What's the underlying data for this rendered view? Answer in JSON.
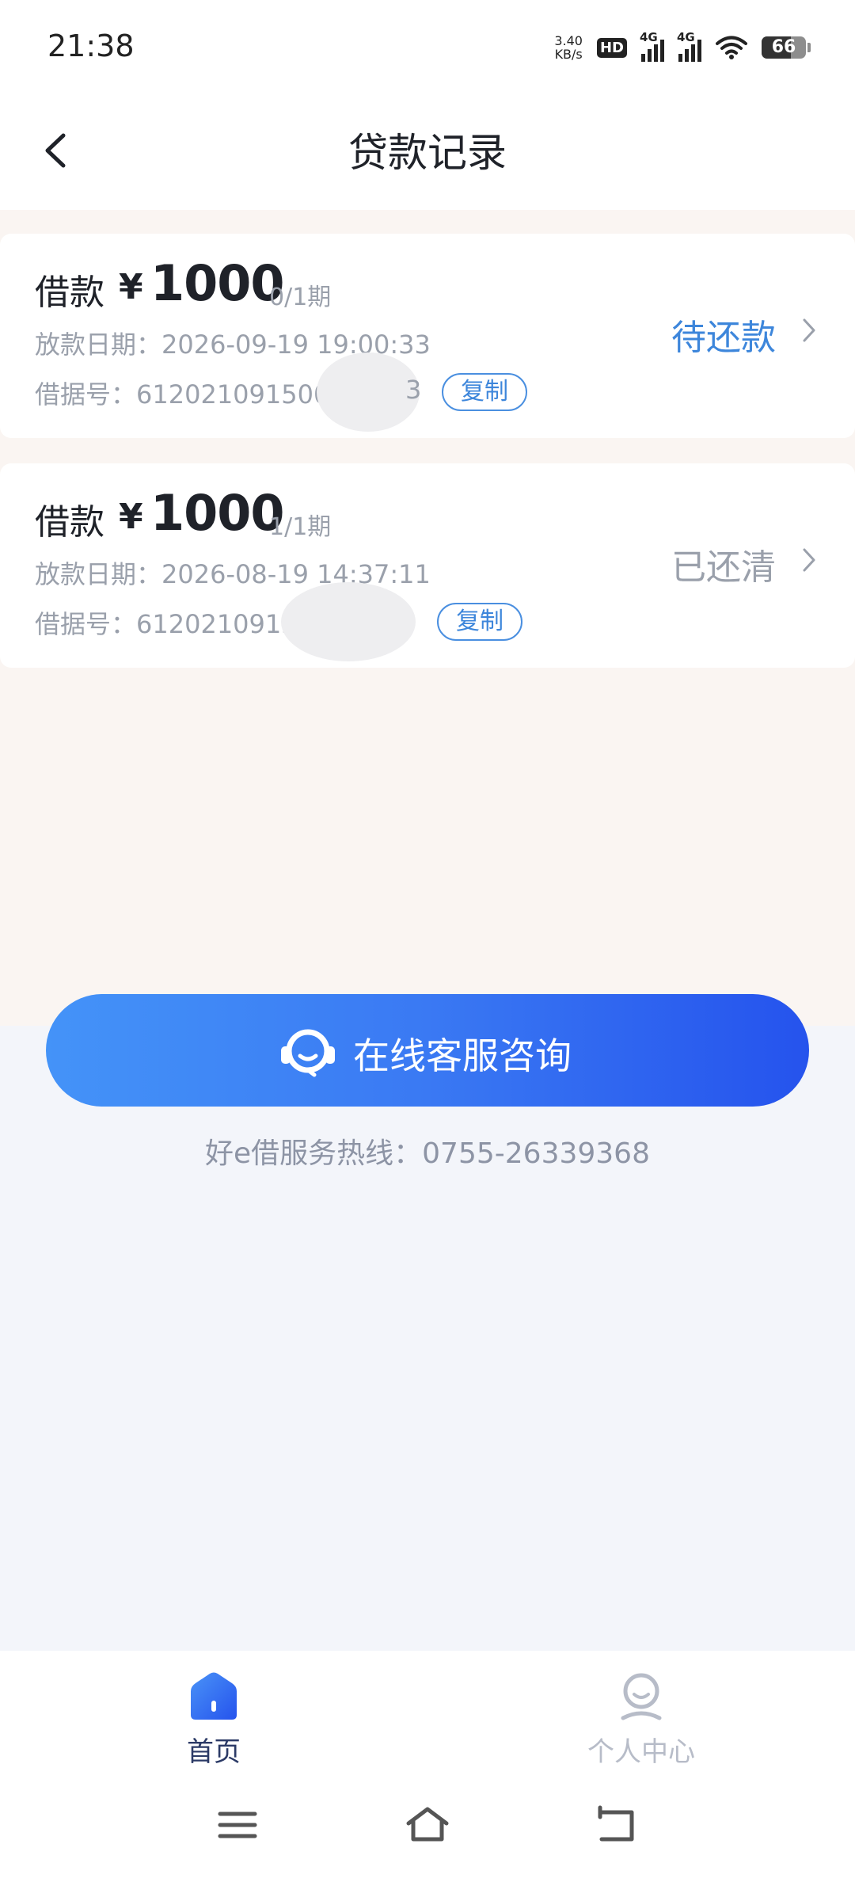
{
  "status_bar": {
    "time": "21:38",
    "net_speed_value": "3.40",
    "net_speed_unit": "KB/s",
    "hd_label": "HD",
    "sim1_label": "4G",
    "sim2_label": "4G",
    "battery": "66",
    "icons": [
      "hd-icon",
      "signal-icon",
      "signal-icon",
      "wifi-icon",
      "battery-icon"
    ]
  },
  "header": {
    "title": "贷款记录",
    "back_icon": "chevron-left-icon"
  },
  "loans": [
    {
      "label": "借款",
      "currency": "¥",
      "amount": "1000",
      "period": "0/1期",
      "date_label": "放款日期：",
      "date": "2026-09-19 19:00:33",
      "no_label": "借据号：",
      "no": "612021091500",
      "no_tail": "3",
      "copy_label": "复制",
      "status": "待还款",
      "status_color": "#3d86db"
    },
    {
      "label": "借款",
      "currency": "¥",
      "amount": "1000",
      "period": "1/1期",
      "date_label": "放款日期：",
      "date": "2026-08-19 14:37:11",
      "no_label": "借据号：",
      "no": "6120210915",
      "no_tail": "",
      "copy_label": "复制",
      "status": "已还清",
      "status_color": "#9aa0ab"
    }
  ],
  "service": {
    "button_label": "在线客服咨询",
    "icon": "headset-icon",
    "hotline": "好e借服务热线：0755-26339368"
  },
  "tabbar": {
    "items": [
      {
        "label": "首页",
        "icon": "home-icon",
        "active": true,
        "color": "#2b3a66"
      },
      {
        "label": "个人中心",
        "icon": "user-icon",
        "active": false,
        "color": "#b7bcc8"
      }
    ]
  },
  "navbar": {
    "icons": [
      "menu-icon",
      "home-outline-icon",
      "back-icon"
    ]
  },
  "colors": {
    "accent": "#3d86db",
    "button_gradient_start": "#4493f8",
    "button_gradient_end": "#2553ed"
  }
}
